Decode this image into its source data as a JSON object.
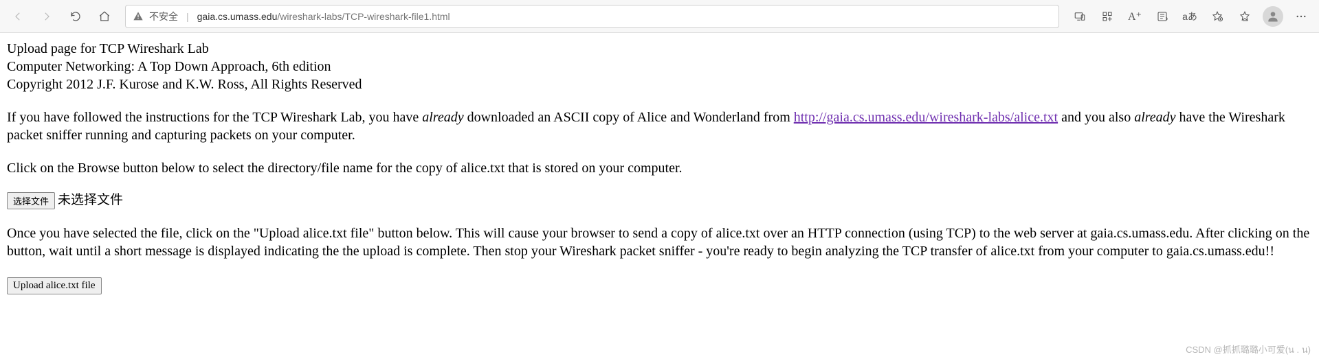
{
  "chrome": {
    "insecure_label": "不安全",
    "url_host": "gaia.cs.umass.edu",
    "url_path": "/wireshark-labs/TCP-wireshark-file1.html",
    "aa_label": "aあ",
    "aplus_label": "A⁺"
  },
  "page": {
    "h1": "Upload page for TCP Wireshark Lab",
    "h2": "Computer Networking: A Top Down Approach, 6th edition",
    "h3": "Copyright 2012 J.F. Kurose and K.W. Ross, All Rights Reserved",
    "p1a": "If you have followed the instructions for the TCP Wireshark Lab, you have ",
    "p1_em1": "already",
    "p1b": " downloaded an ASCII copy of Alice and Wonderland from ",
    "p1_link": "http://gaia.cs.umass.edu/wireshark-labs/alice.txt",
    "p1c": " and you also ",
    "p1_em2": "already",
    "p1d": " have the Wireshark packet sniffer running and capturing packets on your computer.",
    "p2": "Click on the Browse button below to select the directory/file name for the copy of alice.txt that is stored on your computer.",
    "choose_btn": "选择文件",
    "no_file": "未选择文件",
    "p3": "Once you have selected the file, click on the \"Upload alice.txt file\" button below. This will cause your browser to send a copy of alice.txt over an HTTP connection (using TCP) to the web server at gaia.cs.umass.edu. After clicking on the button, wait until a short message is displayed indicating the the upload is complete. Then stop your Wireshark packet sniffer - you're ready to begin analyzing the TCP transfer of alice.txt from your computer to gaia.cs.umass.edu!!",
    "upload_btn": "Upload alice.txt file"
  },
  "watermark": "CSDN @抓抓璐璐小可爱(น . น)"
}
